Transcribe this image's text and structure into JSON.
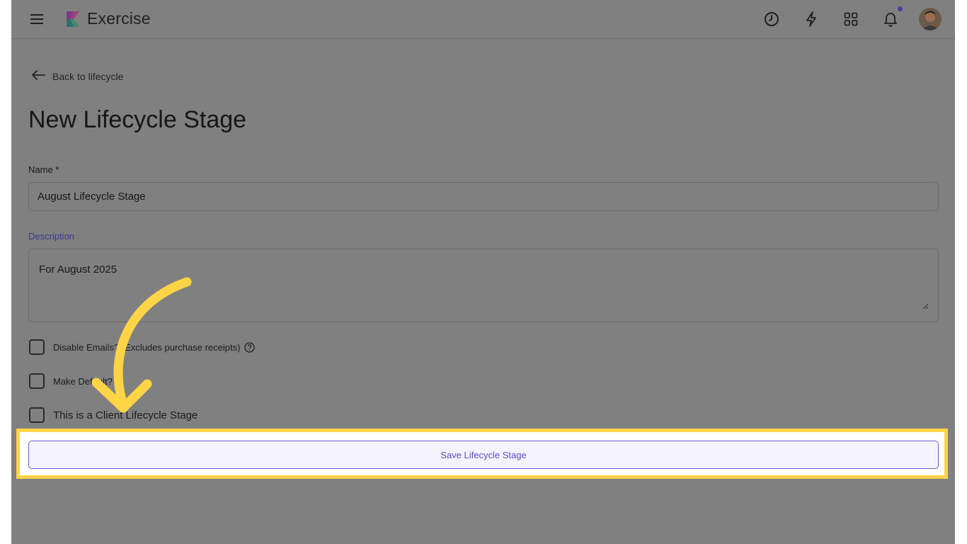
{
  "header": {
    "app_title": "Exercise",
    "accent_color": "#4b3aa8"
  },
  "back_link": {
    "label": "Back to lifecycle"
  },
  "page": {
    "title": "New Lifecycle Stage"
  },
  "form": {
    "name_label": "Name *",
    "name_value": "August Lifecycle Stage",
    "description_label": "Description",
    "description_value": "For August 2025",
    "checkboxes": [
      {
        "label": "Disable Emails? (Excludes purchase receipts)",
        "checked": false
      },
      {
        "label": "Make Default?",
        "checked": false
      },
      {
        "label": "This is a Client Lifecycle Stage",
        "checked": false
      }
    ],
    "save_label": "Save Lifecycle Stage"
  },
  "colors": {
    "highlight": "#ffd445",
    "overlay": "#808080",
    "button_text": "#5a4bcf"
  }
}
